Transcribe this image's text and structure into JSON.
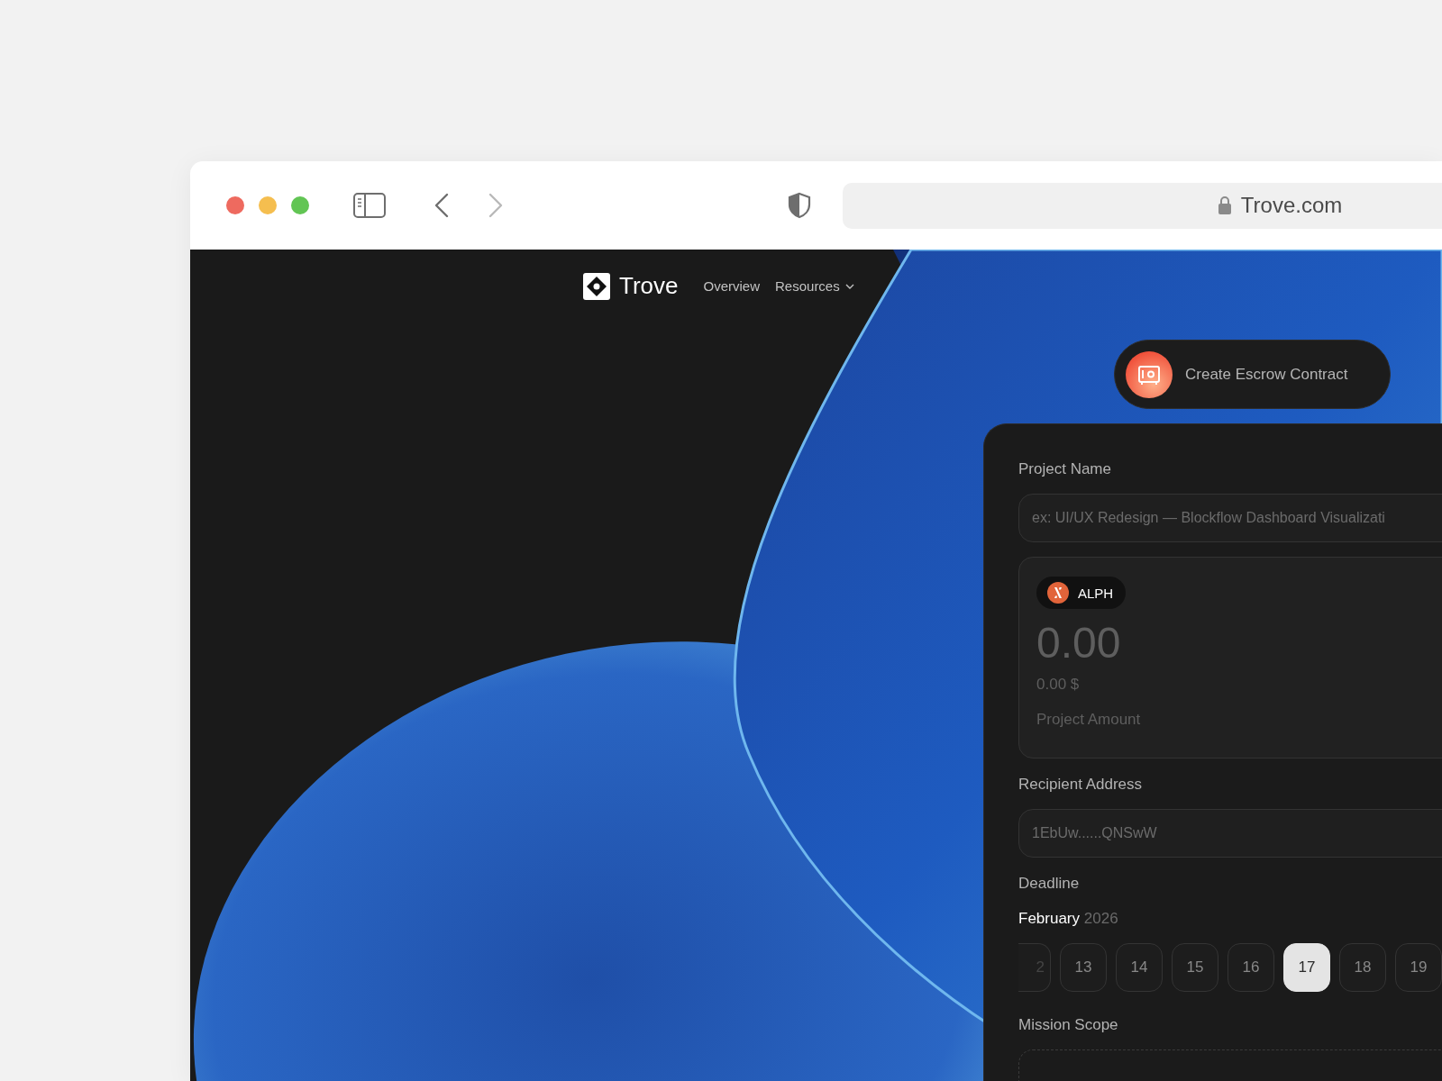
{
  "browser": {
    "url": "Trove.com"
  },
  "nav": {
    "brand": "Trove",
    "links": [
      {
        "label": "Overview",
        "kind": "link"
      },
      {
        "label": "Resources",
        "kind": "dropdown"
      }
    ]
  },
  "create_button": {
    "label": "Create Escrow Contract"
  },
  "form": {
    "project_name": {
      "label": "Project Name",
      "placeholder": "ex: UI/UX Redesign — Blockflow Dashboard Visualizati"
    },
    "amount": {
      "token": "ALPH",
      "value": "0.00",
      "fiat": "0.00 $",
      "label": "Project Amount"
    },
    "recipient": {
      "label": "Recipient Address",
      "placeholder": "1EbUw......QNSwW"
    },
    "deadline": {
      "label": "Deadline",
      "month": "February",
      "year": "2026",
      "dates": [
        {
          "day": "2",
          "kind": "partial",
          "selected": false
        },
        {
          "day": "13",
          "kind": "full",
          "selected": false
        },
        {
          "day": "14",
          "kind": "full",
          "selected": false
        },
        {
          "day": "15",
          "kind": "full",
          "selected": false
        },
        {
          "day": "16",
          "kind": "full",
          "selected": false
        },
        {
          "day": "17",
          "kind": "full",
          "selected": true
        },
        {
          "day": "18",
          "kind": "full",
          "selected": false
        },
        {
          "day": "19",
          "kind": "full",
          "selected": false
        }
      ]
    },
    "mission_scope": {
      "label": "Mission Scope"
    }
  }
}
